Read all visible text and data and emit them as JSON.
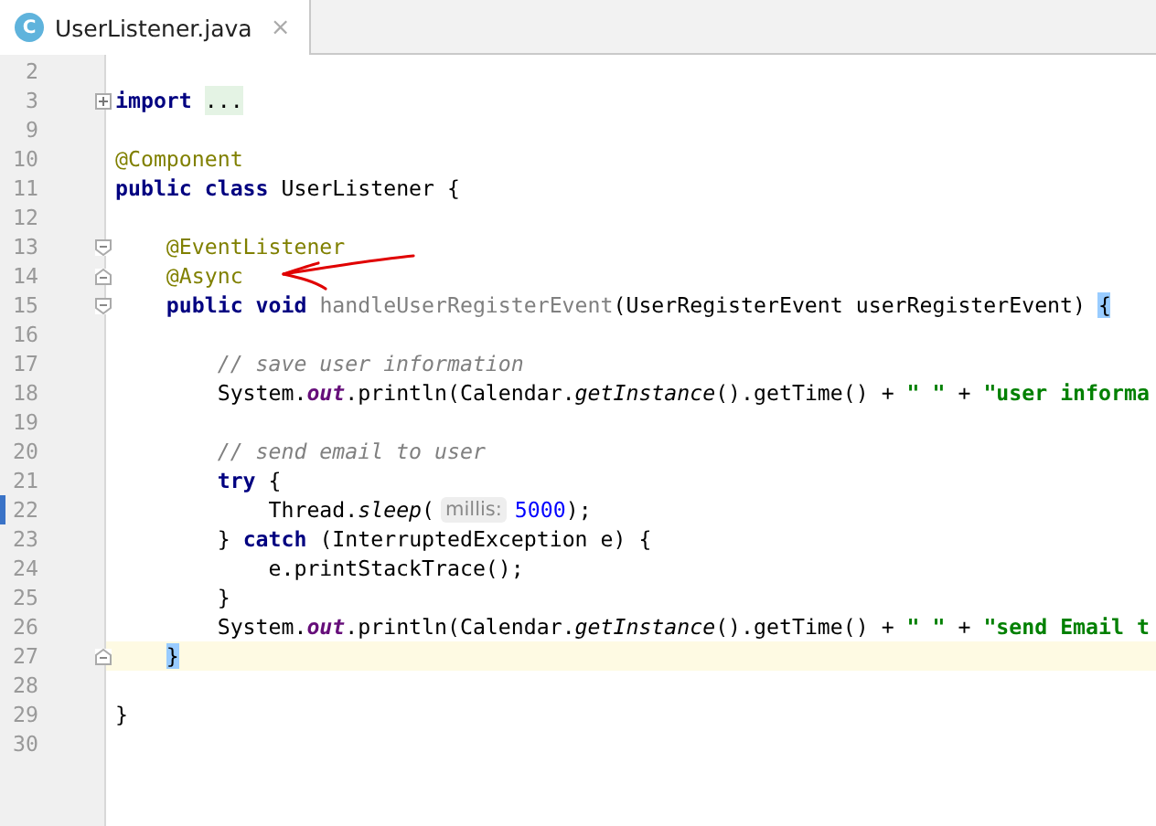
{
  "tabs": [
    {
      "label": "UserListener.java",
      "icon": "C",
      "close": "×",
      "selected": true
    }
  ],
  "lines": [
    {
      "number": "2",
      "current": false,
      "modified": false
    },
    {
      "number": "3",
      "current": false,
      "modified": false,
      "fold": {
        "kind": "expand"
      },
      "tokens": [
        {
          "kind": "kw",
          "text": "import "
        },
        {
          "kind": "folded",
          "text": "..."
        }
      ]
    },
    {
      "number": "9",
      "current": false,
      "modified": false
    },
    {
      "number": "10",
      "current": false,
      "modified": false,
      "tokens": [
        {
          "kind": "ann",
          "text": "@Component"
        }
      ]
    },
    {
      "number": "11",
      "current": false,
      "modified": false,
      "tokens": [
        {
          "kind": "kw",
          "text": "public class "
        },
        {
          "kind": "plain",
          "text": "UserListener {"
        }
      ]
    },
    {
      "number": "12",
      "current": false,
      "modified": false
    },
    {
      "number": "13",
      "current": false,
      "modified": false,
      "fold": {
        "kind": "start"
      },
      "tokens": [
        {
          "kind": "ann",
          "text": "    @EventListener"
        }
      ]
    },
    {
      "number": "14",
      "current": false,
      "modified": false,
      "fold": {
        "kind": "end"
      },
      "tokens": [
        {
          "kind": "ann",
          "text": "    @Async"
        }
      ]
    },
    {
      "number": "15",
      "current": false,
      "modified": false,
      "fold": {
        "kind": "start"
      },
      "tokens": [
        {
          "kind": "kw",
          "text": "    public void "
        },
        {
          "kind": "unused",
          "text": "handleUserRegisterEvent"
        },
        {
          "kind": "plain",
          "text": "(UserRegisterEvent userRegisterEvent) "
        },
        {
          "kind": "brace",
          "text": "{"
        }
      ]
    },
    {
      "number": "16",
      "current": false,
      "modified": false
    },
    {
      "number": "17",
      "current": false,
      "modified": false,
      "tokens": [
        {
          "kind": "comment",
          "text": "        // save user information"
        }
      ]
    },
    {
      "number": "18",
      "current": false,
      "modified": false,
      "tokens": [
        {
          "kind": "plain",
          "text": "        System."
        },
        {
          "kind": "static",
          "text": "out"
        },
        {
          "kind": "plain",
          "text": ".println(Calendar."
        },
        {
          "kind": "italic",
          "text": "getInstance"
        },
        {
          "kind": "plain",
          "text": "().getTime() + "
        },
        {
          "kind": "str",
          "text": "\" \""
        },
        {
          "kind": "plain",
          "text": " + "
        },
        {
          "kind": "str",
          "text": "\"user informa"
        }
      ]
    },
    {
      "number": "19",
      "current": false,
      "modified": false
    },
    {
      "number": "20",
      "current": false,
      "modified": false,
      "tokens": [
        {
          "kind": "comment",
          "text": "        // send email to user"
        }
      ]
    },
    {
      "number": "21",
      "current": false,
      "modified": false,
      "tokens": [
        {
          "kind": "kw",
          "text": "        try "
        },
        {
          "kind": "plain",
          "text": "{"
        }
      ]
    },
    {
      "number": "22",
      "current": false,
      "modified": true,
      "tokens": [
        {
          "kind": "plain",
          "text": "            Thread."
        },
        {
          "kind": "italic",
          "text": "sleep"
        },
        {
          "kind": "plain",
          "text": "("
        },
        {
          "kind": "hint",
          "text": "millis:"
        },
        {
          "kind": "num",
          "text": "5000"
        },
        {
          "kind": "plain",
          "text": ");"
        }
      ]
    },
    {
      "number": "23",
      "current": false,
      "modified": false,
      "tokens": [
        {
          "kind": "plain",
          "text": "        } "
        },
        {
          "kind": "kw",
          "text": "catch "
        },
        {
          "kind": "plain",
          "text": "(InterruptedException e) {"
        }
      ]
    },
    {
      "number": "24",
      "current": false,
      "modified": false,
      "tokens": [
        {
          "kind": "plain",
          "text": "            e.printStackTrace();"
        }
      ]
    },
    {
      "number": "25",
      "current": false,
      "modified": false,
      "tokens": [
        {
          "kind": "plain",
          "text": "        }"
        }
      ]
    },
    {
      "number": "26",
      "current": false,
      "modified": false,
      "tokens": [
        {
          "kind": "plain",
          "text": "        System."
        },
        {
          "kind": "static",
          "text": "out"
        },
        {
          "kind": "plain",
          "text": ".println(Calendar."
        },
        {
          "kind": "italic",
          "text": "getInstance"
        },
        {
          "kind": "plain",
          "text": "().getTime() + "
        },
        {
          "kind": "str",
          "text": "\" \""
        },
        {
          "kind": "plain",
          "text": " + "
        },
        {
          "kind": "str",
          "text": "\"send Email t"
        }
      ]
    },
    {
      "number": "27",
      "current": true,
      "modified": false,
      "fold": {
        "kind": "end"
      },
      "tokens": [
        {
          "kind": "brace",
          "text": "    }"
        }
      ]
    },
    {
      "number": "28",
      "current": false,
      "modified": false
    },
    {
      "number": "29",
      "current": false,
      "modified": false,
      "tokens": [
        {
          "kind": "plain",
          "text": "}"
        }
      ]
    },
    {
      "number": "30",
      "current": false,
      "modified": false
    }
  ]
}
